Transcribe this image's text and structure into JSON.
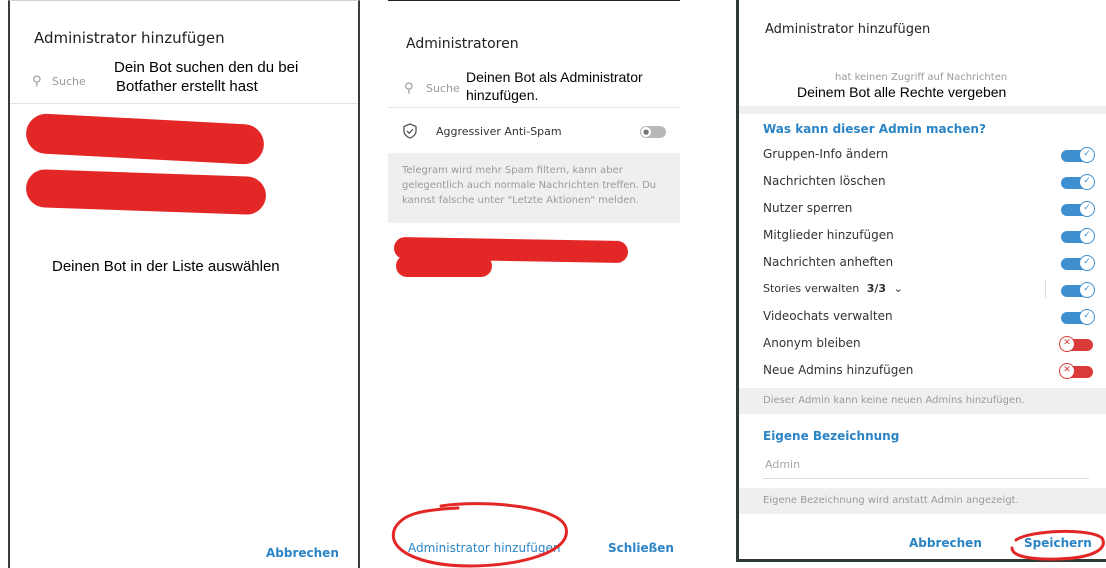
{
  "colors": {
    "accent": "#2a84c6",
    "toggle_on": "#3d8fd0",
    "toggle_off": "#d93a3a",
    "annotation_red": "#e32626"
  },
  "panel1": {
    "title": "Administrator hinzufügen",
    "search_placeholder": "Suche",
    "annotation_search_1": "Dein Bot suchen den du bei",
    "annotation_search_2": "Botfather erstellt hast",
    "annotation_list": "Deinen Bot in der Liste auswählen",
    "cancel_label": "Abbrechen"
  },
  "panel2": {
    "title": "Administratoren",
    "search_placeholder": "Suche",
    "annotation_1": "Deinen Bot als Administrator",
    "annotation_2": "hinzufügen.",
    "antispam_label": "Aggressiver Anti-Spam",
    "antispam_hint_1": "Telegram wird mehr Spam filtern, kann aber",
    "antispam_hint_2": "gelegentlich auch normale Nachrichten treffen. Du",
    "antispam_hint_3": "kannst falsche unter \"Letzte Aktionen\" melden.",
    "add_admin_label": "Administrator hinzufügen",
    "close_label": "Schließen"
  },
  "panel3": {
    "title": "Administrator hinzufügen",
    "no_access": "hat keinen Zugriff auf Nachrichten",
    "annotation": "Deinem Bot alle Rechte vergeben",
    "section_title": "Was kann dieser Admin machen?",
    "permissions": [
      {
        "label": "Gruppen-Info ändern",
        "enabled": true
      },
      {
        "label": "Nachrichten löschen",
        "enabled": true
      },
      {
        "label": "Nutzer sperren",
        "enabled": true
      },
      {
        "label": "Mitglieder hinzufügen",
        "enabled": true
      },
      {
        "label": "Nachrichten anheften",
        "enabled": true
      },
      {
        "label": "Stories verwalten",
        "count": "3/3",
        "enabled": true
      },
      {
        "label": "Videochats verwalten",
        "enabled": true
      },
      {
        "label": "Anonym bleiben",
        "enabled": false
      },
      {
        "label": "Neue Admins hinzufügen",
        "enabled": false
      }
    ],
    "admins_note": "Dieser Admin kann keine neuen Admins hinzufügen.",
    "custom_title_head": "Eigene Bezeichnung",
    "custom_title_placeholder": "Admin",
    "custom_title_note": "Eigene Bezeichnung wird anstatt Admin angezeigt.",
    "cancel_label": "Abbrechen",
    "save_label": "Speichern"
  }
}
